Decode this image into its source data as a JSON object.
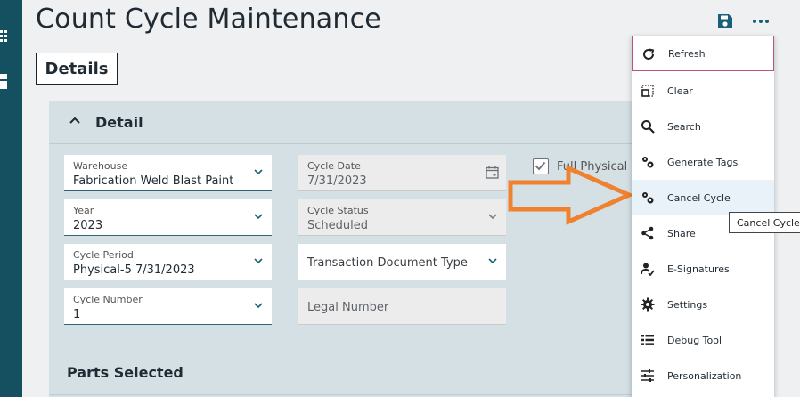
{
  "page": {
    "title": "Count Cycle Maintenance"
  },
  "tabs": {
    "details": "Details"
  },
  "panel": {
    "title": "Detail"
  },
  "fields": {
    "warehouse": {
      "label": "Warehouse",
      "value": "Fabrication Weld Blast Paint"
    },
    "year": {
      "label": "Year",
      "value": "2023"
    },
    "cycle_period": {
      "label": "Cycle Period",
      "value": "Physical-5 7/31/2023"
    },
    "cycle_number": {
      "label": "Cycle Number",
      "value": "1"
    },
    "cycle_date": {
      "label": "Cycle Date",
      "value": "7/31/2023"
    },
    "cycle_status": {
      "label": "Cycle Status",
      "value": "Scheduled"
    },
    "transaction_document_type": {
      "placeholder": "Transaction Document Type"
    },
    "legal_number": {
      "placeholder": "Legal Number"
    },
    "full_physical": {
      "label": "Full Physical",
      "checked": true
    }
  },
  "sections": {
    "parts_selected": "Parts Selected"
  },
  "menu": {
    "items": [
      {
        "label": "Refresh",
        "icon": "refresh-icon"
      },
      {
        "label": "Clear",
        "icon": "clear-icon"
      },
      {
        "label": "Search",
        "icon": "search-icon"
      },
      {
        "label": "Generate Tags",
        "icon": "gears-icon"
      },
      {
        "label": "Cancel Cycle",
        "icon": "gears-icon"
      },
      {
        "label": "Share",
        "icon": "share-icon"
      },
      {
        "label": "E-Signatures",
        "icon": "signature-icon"
      },
      {
        "label": "Settings",
        "icon": "gear-icon"
      },
      {
        "label": "Debug Tool",
        "icon": "list-icon"
      },
      {
        "label": "Personalization",
        "icon": "sliders-icon"
      }
    ]
  },
  "tooltip": {
    "text": "Cancel Cycle"
  },
  "colors": {
    "rail": "#14505f",
    "accent": "#1a5f7a",
    "arrow": "#f0812e",
    "panel": "#d4e0e4"
  }
}
